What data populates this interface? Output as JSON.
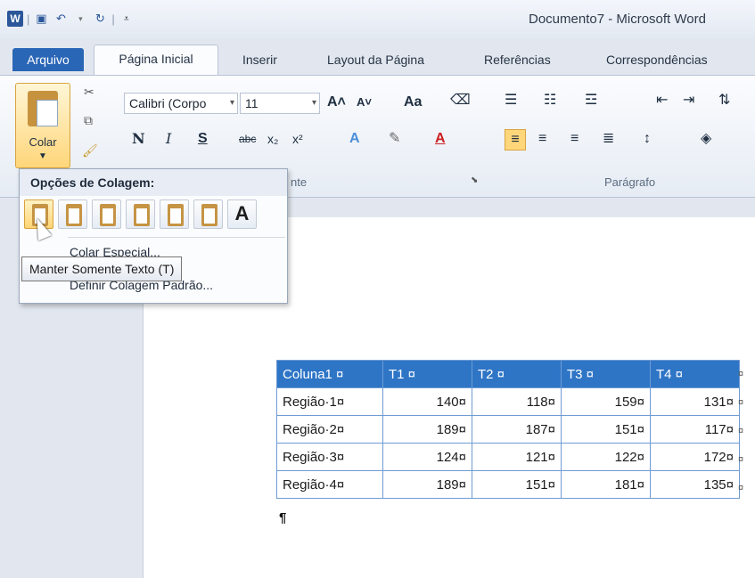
{
  "window": {
    "title": "Documento7 - Microsoft Word"
  },
  "quick_access": {
    "icons": [
      "word-icon",
      "save-icon",
      "undo-icon",
      "redo-icon",
      "customize-icon"
    ]
  },
  "tabs": [
    {
      "label": "Arquivo"
    },
    {
      "label": "Página Inicial"
    },
    {
      "label": "Inserir"
    },
    {
      "label": "Layout da Página"
    },
    {
      "label": "Referências"
    },
    {
      "label": "Correspondências"
    }
  ],
  "ribbon": {
    "paste_label": "Colar",
    "font_name": "Calibri (Corpo",
    "font_size": "11",
    "group_fonte": "nte",
    "group_paragrafo": "Parágrafo",
    "bold": "N",
    "italic": "I",
    "underline": "S",
    "strike": "abc",
    "sub": "x₂",
    "sup": "x²",
    "grow": "A˄",
    "shrink": "A˅",
    "case": "Aa"
  },
  "paste_menu": {
    "title": "Opções de Colagem:",
    "options": [
      "keep-source-formatting",
      "merge-formatting",
      "nest-table",
      "merge-table",
      "insert-as-rows",
      "picture",
      "keep-text-only"
    ],
    "item_special": "Colar Especial...",
    "item_default": "Definir Colagem Padrão..."
  },
  "tooltip": {
    "text": "Manter Somente Texto (T)"
  },
  "table": {
    "headers": [
      "Coluna1 ¤",
      "T1 ¤",
      "T2 ¤",
      "T3 ¤",
      "T4 ¤"
    ],
    "rows": [
      [
        "Região·1¤",
        "140¤",
        "118¤",
        "159¤",
        "131¤"
      ],
      [
        "Região·2¤",
        "189¤",
        "187¤",
        "151¤",
        "117¤"
      ],
      [
        "Região·3¤",
        "124¤",
        "121¤",
        "122¤",
        "172¤"
      ],
      [
        "Região·4¤",
        "189¤",
        "151¤",
        "181¤",
        "135¤"
      ]
    ],
    "end_of_row_mark": "¤",
    "paragraph_mark": "¶"
  },
  "colors": {
    "file_tab": "#2a66b6",
    "table_header": "#2e75c6",
    "paste_highlight": "#ffd67a"
  }
}
